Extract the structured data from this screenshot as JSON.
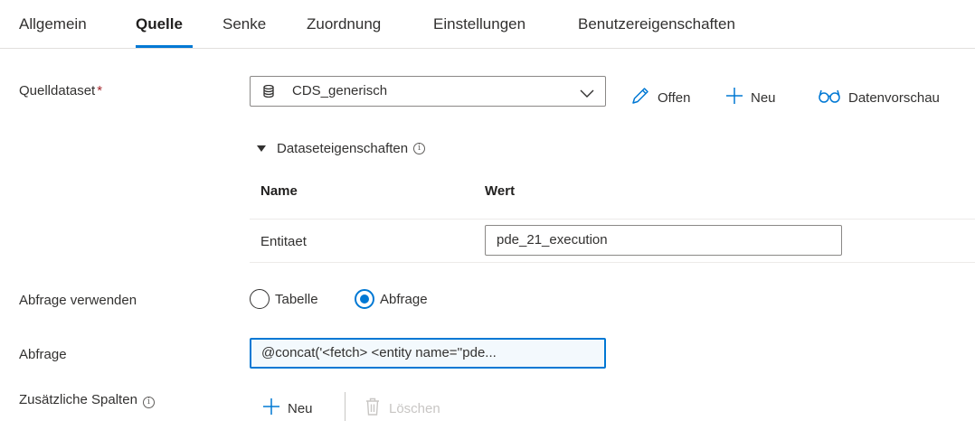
{
  "tabs": [
    {
      "label": "Allgemein",
      "active": false
    },
    {
      "label": "Quelle",
      "active": true
    },
    {
      "label": "Senke",
      "active": false
    },
    {
      "label": "Zuordnung",
      "active": false
    },
    {
      "label": "Einstellungen",
      "active": false
    },
    {
      "label": "Benutzereigenschaften",
      "active": false
    }
  ],
  "source_dataset": {
    "label": "Quelldataset",
    "required_mark": "*",
    "value": "CDS_generisch"
  },
  "actions": {
    "open": "Offen",
    "new": "Neu",
    "preview": "Datenvorschau"
  },
  "dataset_properties": {
    "title": "Dataseteigenschaften",
    "info": "i",
    "col_name": "Name",
    "col_value": "Wert",
    "rows": [
      {
        "name": "Entitaet",
        "value": "pde_21_execution"
      }
    ]
  },
  "use_query": {
    "label": "Abfrage verwenden",
    "options": [
      "Tabelle",
      "Abfrage"
    ],
    "selected": "Abfrage"
  },
  "query": {
    "label": "Abfrage",
    "value": "@concat('<fetch> <entity name=''pde..."
  },
  "additional_columns": {
    "label": "Zusätzliche Spalten",
    "info": "i",
    "new": "Neu",
    "delete": "Löschen"
  },
  "colors": {
    "accent": "#0078d4",
    "text": "#323130",
    "disabled": "#c8c6c4"
  }
}
